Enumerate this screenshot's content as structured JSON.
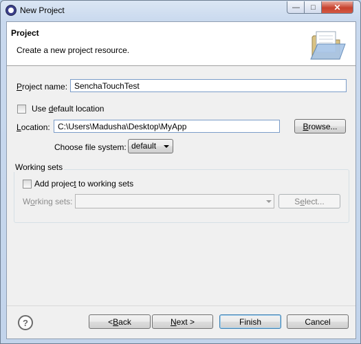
{
  "window": {
    "title": "New Project",
    "minimize_glyph": "—",
    "maximize_glyph": "□",
    "close_glyph": "✕"
  },
  "banner": {
    "title": "Project",
    "description": "Create a new project resource.",
    "icon": "open-folder-icon"
  },
  "project_name": {
    "label_pre": "",
    "label_mnemonic": "P",
    "label_post": "roject name:",
    "value": "SenchaTouchTest"
  },
  "use_default_location": {
    "label_pre": "Use ",
    "label_mnemonic": "d",
    "label_post": "efault location",
    "checked": false
  },
  "location": {
    "label_pre": "",
    "label_mnemonic": "L",
    "label_post": "ocation:",
    "value": "C:\\Users\\Madusha\\Desktop\\MyApp",
    "browse_pre": "",
    "browse_mnemonic": "B",
    "browse_post": "rowse..."
  },
  "file_system": {
    "label": "Choose file system:",
    "selected": "default"
  },
  "working_sets": {
    "group_title": "Working sets",
    "add_pre": "Add projec",
    "add_mnemonic": "t",
    "add_post": " to working sets",
    "add_checked": false,
    "sets_pre": "W",
    "sets_mnemonic": "o",
    "sets_post": "rking sets:",
    "select_pre": "S",
    "select_mnemonic": "e",
    "select_post": "lect..."
  },
  "footer": {
    "help_glyph": "?",
    "back_pre": "< ",
    "back_mnemonic": "B",
    "back_post": "ack",
    "next_pre": "",
    "next_mnemonic": "N",
    "next_post": "ext >",
    "finish": "Finish",
    "cancel": "Cancel"
  },
  "colors": {
    "title_bar": "#c9d9ee",
    "close_button": "#c7432e",
    "default_button_border": "#3c7fb1",
    "field_border": "#7a9cc8"
  }
}
